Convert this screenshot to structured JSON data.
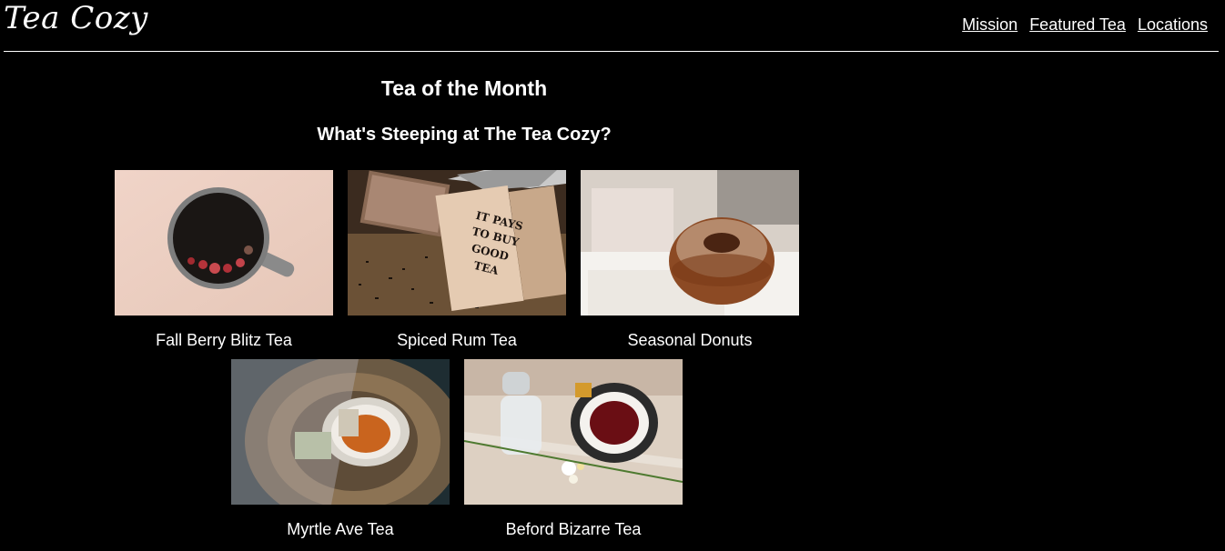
{
  "header": {
    "logo": "Tea Cozy",
    "nav": [
      {
        "label": "Mission"
      },
      {
        "label": "Featured Tea"
      },
      {
        "label": "Locations"
      }
    ]
  },
  "main": {
    "title": "Tea of the Month",
    "subtitle": "What's Steeping at The Tea Cozy?",
    "teas": [
      {
        "caption": "Fall Berry Blitz Tea",
        "image": "berry-tea-mug-photo"
      },
      {
        "caption": "Spiced Rum Tea",
        "image": "tea-box-photo",
        "box_text": [
          "IT PAYS",
          "TO BUY",
          "GOOD",
          "TEA"
        ]
      },
      {
        "caption": "Seasonal Donuts",
        "image": "donut-photo"
      },
      {
        "caption": "Myrtle Ave Tea",
        "image": "tea-cup-on-wood-photo"
      },
      {
        "caption": "Beford Bizarre Tea",
        "image": "red-tea-cup-photo"
      }
    ]
  }
}
